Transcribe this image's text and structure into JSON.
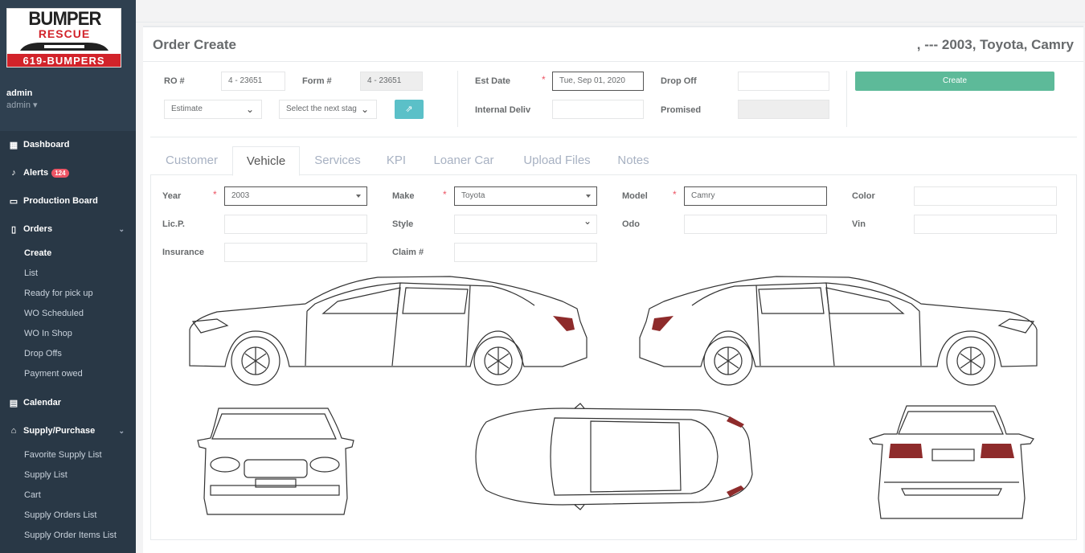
{
  "brand": {
    "line1": "BUMPER",
    "line2": "RESCUE",
    "line3": "619-BUMPERS"
  },
  "user": {
    "name": "admin",
    "role": "admin"
  },
  "nav": {
    "dashboard": "Dashboard",
    "alerts": "Alerts",
    "alerts_count": "124",
    "production": "Production Board",
    "orders": "Orders",
    "orders_sub": [
      "Create",
      "List",
      "Ready for pick up",
      "WO Scheduled",
      "WO In Shop",
      "Drop Offs",
      "Payment owed"
    ],
    "calendar": "Calendar",
    "supply": "Supply/Purchase",
    "supply_sub": [
      "Favorite Supply List",
      "Supply List",
      "Cart",
      "Supply Orders List",
      "Supply Order Items List"
    ]
  },
  "page": {
    "title": "Order Create",
    "vehicle_summary": ", --- 2003, Toyota, Camry"
  },
  "order": {
    "ro_label": "RO #",
    "ro_value": "4 - 23651",
    "form_label": "Form #",
    "form_value": "4 - 23651",
    "type_value": "Estimate",
    "stage_placeholder": "Select the next stag",
    "est_date_label": "Est Date",
    "est_date_value": "Tue, Sep 01, 2020",
    "internal_label": "Internal Deliv",
    "drop_off_label": "Drop Off",
    "promised_label": "Promised",
    "create_label": "Create"
  },
  "tabs": [
    "Customer",
    "Vehicle",
    "Services",
    "KPI",
    "Loaner Car",
    "Upload Files",
    "Notes"
  ],
  "vehicle": {
    "year_label": "Year",
    "year_value": "2003",
    "make_label": "Make",
    "make_value": "Toyota",
    "model_label": "Model",
    "model_value": "Camry",
    "color_label": "Color",
    "licp_label": "Lic.P.",
    "style_label": "Style",
    "odo_label": "Odo",
    "vin_label": "Vin",
    "insurance_label": "Insurance",
    "claim_label": "Claim #"
  },
  "colors": {
    "sidebar": "#2f4050",
    "accent": "#5dba99",
    "info": "#5bc0c8",
    "danger": "#ed5565",
    "brand_red": "#d2232a"
  }
}
